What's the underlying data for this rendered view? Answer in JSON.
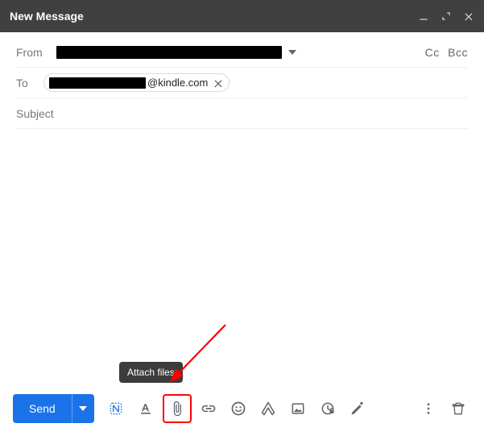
{
  "window": {
    "title": "New Message"
  },
  "from": {
    "label": "From"
  },
  "to": {
    "label": "To",
    "chip_domain": "@kindle.com"
  },
  "ccbcc": {
    "cc": "Cc",
    "bcc": "Bcc"
  },
  "subject": {
    "placeholder": "Subject",
    "value": ""
  },
  "tooltip": {
    "attach": "Attach files"
  },
  "toolbar": {
    "send": "Send"
  }
}
